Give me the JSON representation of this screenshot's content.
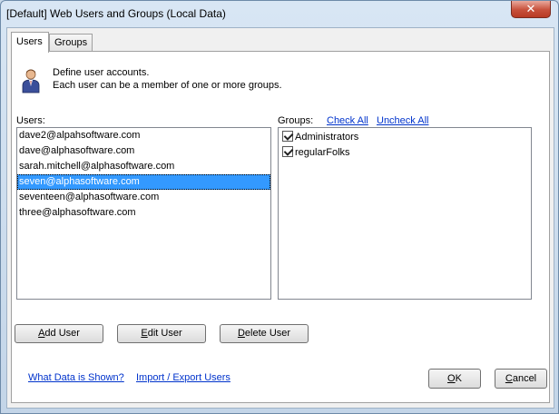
{
  "window": {
    "title": "[Default] Web Users and Groups (Local Data)",
    "close_label": "✕"
  },
  "tabs": [
    {
      "label": "Users"
    },
    {
      "label": "Groups"
    }
  ],
  "description": {
    "line1": "Define user accounts.",
    "line2": "Each user can be a member of one or more groups."
  },
  "users": {
    "label": "Users:",
    "items": [
      "dave2@alpahsoftware.com",
      "dave@alphasoftware.com",
      "sarah.mitchell@alphasoftware.com",
      "seven@alphasoftware.com",
      "seventeen@alphasoftware.com",
      "three@alphasoftware.com"
    ],
    "selected_index": 3
  },
  "groups": {
    "label": "Groups:",
    "check_all": "Check All",
    "uncheck_all": "Uncheck All",
    "items": [
      {
        "label": "Administrators",
        "checked": true
      },
      {
        "label": "regularFolks",
        "checked": true
      }
    ]
  },
  "buttons": {
    "add_user_u": "A",
    "add_user_rest": "dd User",
    "edit_user_u": "E",
    "edit_user_rest": "dit User",
    "delete_user_u": "D",
    "delete_user_rest": "elete User",
    "ok_u": "O",
    "ok_rest": "K",
    "cancel_u": "C",
    "cancel_rest": "ancel"
  },
  "footer_links": {
    "what_data": "What Data is Shown?",
    "import_export": "Import / Export Users"
  }
}
